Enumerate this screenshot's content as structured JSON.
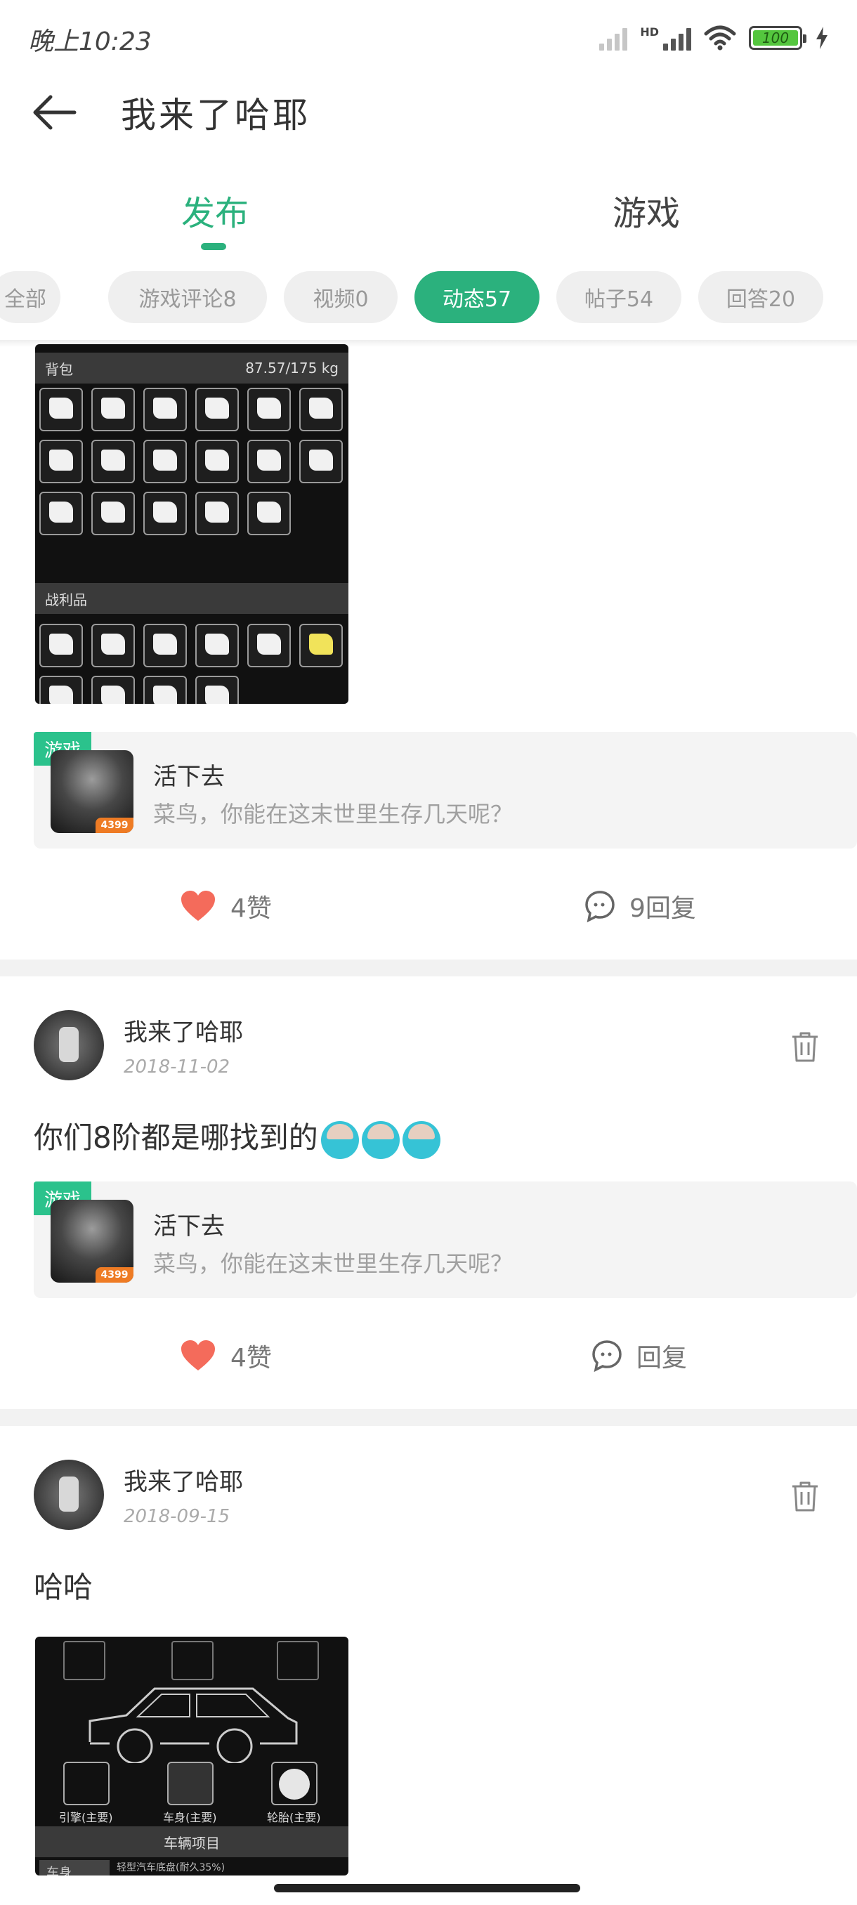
{
  "status_bar": {
    "time": "晚上10:23",
    "hd": "HD",
    "battery": "100"
  },
  "header": {
    "title": "我来了哈耶"
  },
  "tabs": [
    {
      "label": "发布"
    },
    {
      "label": "游戏"
    }
  ],
  "filters": [
    {
      "label": "全部"
    },
    {
      "label": "游戏评论8"
    },
    {
      "label": "视频0"
    },
    {
      "label": "动态57",
      "active": true
    },
    {
      "label": "帖子54"
    },
    {
      "label": "回答20"
    }
  ],
  "colors": {
    "accent": "#2bb17d",
    "tag": "#2bc28c",
    "like": "#f46b5b"
  },
  "inventory_shot": {
    "backpack_label": "背包",
    "weight": "87.57/175 kg",
    "loot_label": "战利品"
  },
  "car_shot": {
    "engine": "引擎(主要)",
    "body": "车身(主要)",
    "wheel": "轮胎(主要)",
    "section": "车辆项目",
    "bottom_left": "车身",
    "bottom_right": "轻型汽车底盘(耐久35%)"
  },
  "game_card": {
    "tag": "游戏",
    "name": "活下去",
    "desc": "菜鸟，你能在这末世里生存几天呢？",
    "badge": "4399"
  },
  "posts": [
    {
      "actions": {
        "likes": "4赞",
        "replies": "9回复"
      }
    },
    {
      "user": "我来了哈耶",
      "date": "2018-11-02",
      "text": "你们8阶都是哪找到的",
      "actions": {
        "likes": "4赞",
        "replies": "回复"
      }
    },
    {
      "user": "我来了哈耶",
      "date": "2018-09-15",
      "text": "哈哈"
    }
  ]
}
